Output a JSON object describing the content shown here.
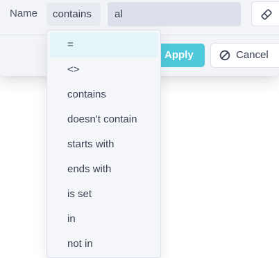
{
  "filter": {
    "field_label": "Name",
    "operator_value": "contains",
    "input_value": "al",
    "apply_label": "Apply",
    "cancel_label": "Cancel"
  },
  "dropdown": {
    "options": [
      "=",
      "<>",
      "contains",
      "doesn't contain",
      "starts with",
      "ends with",
      "is set",
      "in",
      "not in"
    ],
    "highlighted": "="
  },
  "colors": {
    "accent": "#4fc9dc",
    "highlight": "#e4f5f9",
    "panel_bg": "#f3f4f8",
    "text": "#384152"
  },
  "icons": {
    "clear": "eraser-icon",
    "cancel": "ban-icon"
  }
}
